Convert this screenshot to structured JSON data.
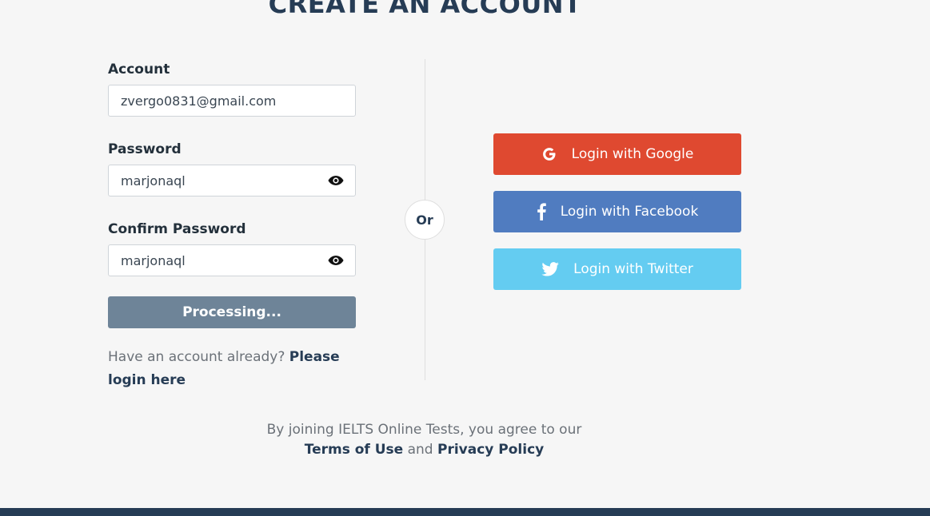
{
  "page": {
    "title": "CREATE AN ACCOUNT"
  },
  "form": {
    "account_label": "Account",
    "account_value": "zvergo0831@gmail.com",
    "password_label": "Password",
    "password_value": "marjonaql",
    "confirm_label": "Confirm Password",
    "confirm_value": "marjonaql",
    "submit_label": "Processing...",
    "have_account_text": "Have an account already?",
    "login_link": "Please login here"
  },
  "divider": {
    "or_label": "Or"
  },
  "social": {
    "google_label": "Login with Google",
    "facebook_label": "Login with Facebook",
    "twitter_label": "Login with Twitter"
  },
  "agreement": {
    "text": "By joining IELTS Online Tests, you agree to our",
    "terms": "Terms of Use",
    "and": "and",
    "privacy": "Privacy Policy"
  },
  "colors": {
    "brand": "#263c55",
    "google": "#df4930",
    "facebook": "#507cc0",
    "twitter": "#64ccf1",
    "processing": "#6e8498"
  }
}
